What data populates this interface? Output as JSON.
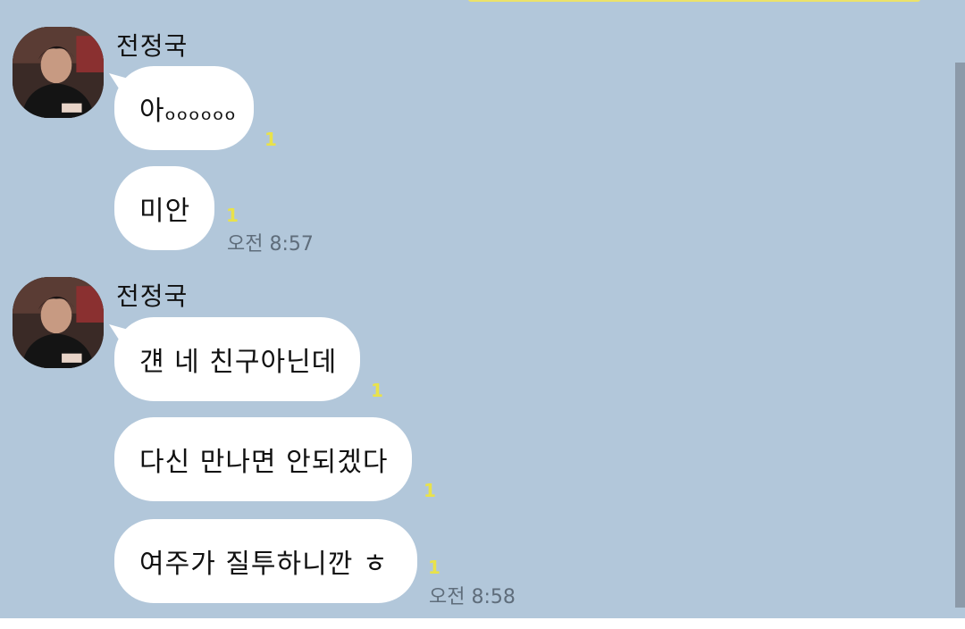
{
  "groups": [
    {
      "sender": "전정국",
      "messages": [
        {
          "text": "아ₒₒₒₒₒₒ",
          "unread": "1"
        },
        {
          "text": "미안",
          "unread": "1"
        }
      ],
      "time": "오전 8:57"
    },
    {
      "sender": "전정국",
      "messages": [
        {
          "text": "걘 네 친구아닌데",
          "unread": "1"
        },
        {
          "text": "다신 만나면 안되겠다",
          "unread": "1"
        },
        {
          "text": "여주가 질투하니깐  ㅎ",
          "unread": "1"
        }
      ],
      "time": "오전 8:58"
    }
  ],
  "colors": {
    "background": "#b2c7da",
    "bubble": "#ffffff",
    "unread": "#e9e24a",
    "time": "#5f6d7b"
  }
}
